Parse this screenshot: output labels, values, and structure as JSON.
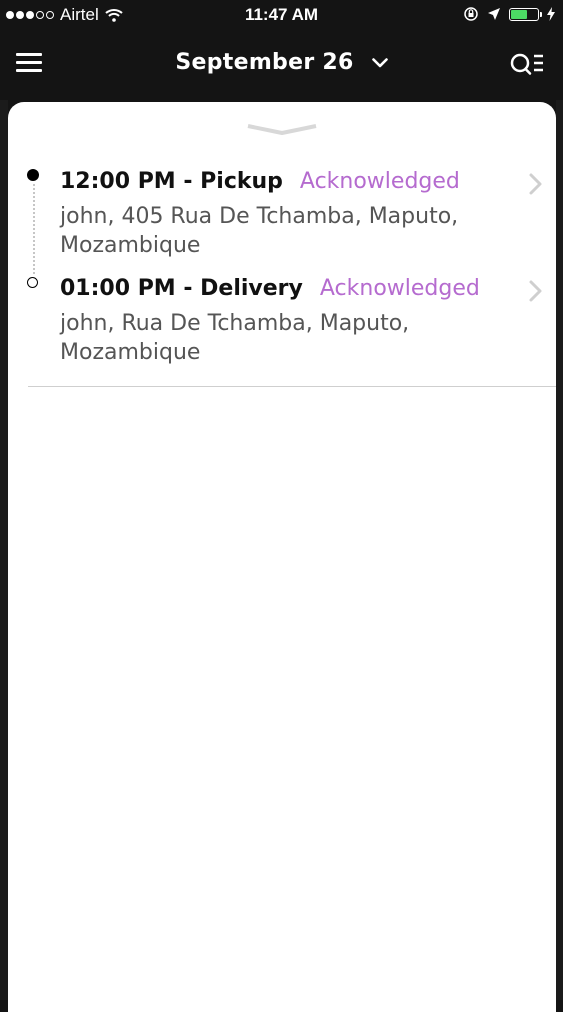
{
  "status_bar": {
    "carrier": "Airtel",
    "time": "11:47 AM",
    "battery_color": "#4cd964"
  },
  "nav": {
    "title": "September 26",
    "menu_icon": "hamburger-menu-icon",
    "search_icon": "search-list-icon",
    "chevron_icon": "chevron-down-icon"
  },
  "stops": [
    {
      "time_type": "12:00 PM - Pickup",
      "status": "Acknowledged",
      "address": "john, 405 Rua De Tchamba, Maputo, Mozambique"
    },
    {
      "time_type": "01:00 PM - Delivery",
      "status": "Acknowledged",
      "address": "john, Rua De Tchamba, Maputo, Mozambique"
    }
  ],
  "colors": {
    "status_accent": "#b56bcf",
    "header_bg": "#141414"
  }
}
